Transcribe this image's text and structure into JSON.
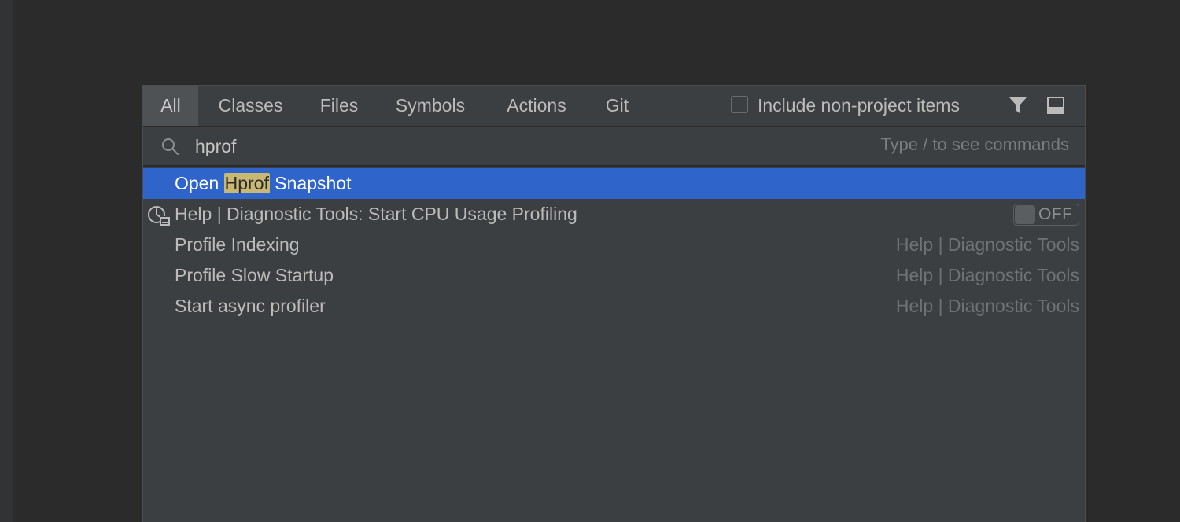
{
  "tabs": [
    {
      "label": "All"
    },
    {
      "label": "Classes"
    },
    {
      "label": "Files"
    },
    {
      "label": "Symbols"
    },
    {
      "label": "Actions"
    },
    {
      "label": "Git"
    }
  ],
  "include_non_project": {
    "label": "Include non-project items",
    "checked": false
  },
  "search": {
    "value": "hprof",
    "hint": "Type / to see commands"
  },
  "results": [
    {
      "prefix": "Open ",
      "highlight": "Hprof",
      "suffix": " Snapshot",
      "location": ""
    },
    {
      "text": "Help | Diagnostic Tools: Start CPU Usage Profiling",
      "toggle": "OFF"
    },
    {
      "text": "Profile Indexing",
      "location": "Help | Diagnostic Tools"
    },
    {
      "text": "Profile Slow Startup",
      "location": "Help | Diagnostic Tools"
    },
    {
      "text": "Start async profiler",
      "location": "Help | Diagnostic Tools"
    }
  ],
  "icons": {
    "search": "search-icon",
    "filter": "filter-icon",
    "preview": "preview-panel-icon",
    "profiler": "profiler-icon"
  },
  "colors": {
    "selection": "#2f65ca",
    "match_highlight": "#c8b873",
    "popup_bg": "#3c3f41"
  }
}
